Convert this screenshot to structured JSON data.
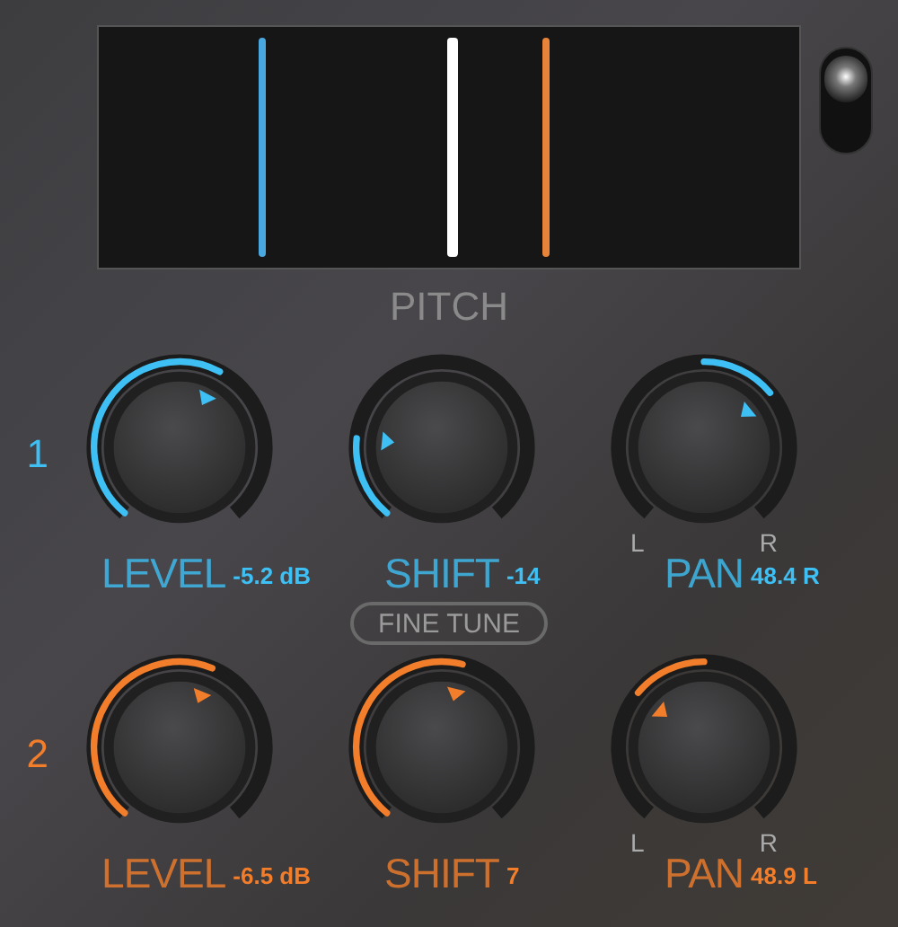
{
  "pitch_display": {
    "title": "PITCH",
    "markers": [
      {
        "color": "#4aa8e0",
        "level": 0.227
      },
      {
        "color": "#ffffff",
        "level": 0.497
      },
      {
        "color": "#e8843a",
        "level": 0.633
      }
    ]
  },
  "toggle_switch": {
    "on": true
  },
  "fine_tune_button": "FINE TUNE",
  "voices": [
    {
      "number": "1",
      "color": "#3ec0f4",
      "knobs": [
        {
          "kind": "unipolar",
          "label": "LEVEL",
          "reading": "-5.2 dB"
        },
        {
          "kind": "unipolar",
          "label": "SHIFT",
          "reading": "-14"
        },
        {
          "kind": "bipolar",
          "label": "PAN",
          "reading": "48.4 R",
          "left_label": "L",
          "right_label": "R"
        }
      ]
    },
    {
      "number": "2",
      "color": "#f27e2c",
      "knobs": [
        {
          "kind": "unipolar",
          "label": "LEVEL",
          "reading": "-6.5 dB"
        },
        {
          "kind": "unipolar",
          "label": "SHIFT",
          "reading": "7"
        },
        {
          "kind": "bipolar",
          "label": "PAN",
          "reading": "48.9 L",
          "left_label": "L",
          "right_label": "R"
        }
      ]
    }
  ]
}
